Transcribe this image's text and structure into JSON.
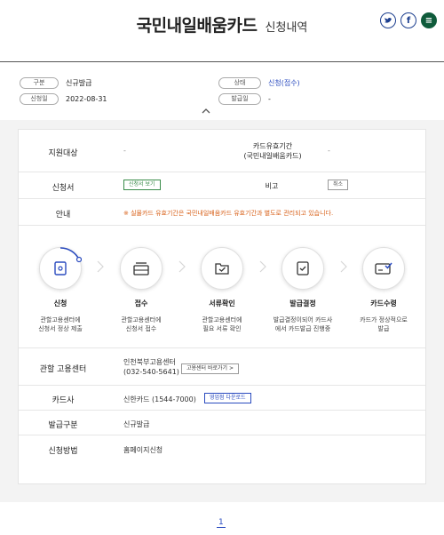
{
  "header": {
    "title": "국민내일배움카드",
    "subtitle": "신청내역",
    "share_twitter": "t",
    "share_facebook": "f",
    "share_other": "≡"
  },
  "summary": {
    "type_label": "구분",
    "type_value": "신규발급",
    "status_label": "상태",
    "status_value": "신청(접수)",
    "apply_date_label": "신청일",
    "apply_date_value": "2022-08-31",
    "issue_date_label": "발급일",
    "issue_date_value": "-"
  },
  "detail": {
    "support_label": "지원대상",
    "support_value": "-",
    "validity_label": "카드유효기간\n(국민내일배움카드)",
    "validity_value": "-",
    "application_label": "신청서",
    "application_button": "신청서 보기",
    "remark_label": "비고",
    "remark_button": "취소",
    "guide_label": "안내",
    "guide_value": "※ 실물카드 유효기간은 국민내일배움카드 유효기간과 별도로 관리되고 있습니다.",
    "center_label": "관할 고용센터",
    "center_name": "인천북부고용센터",
    "center_phone": "(032-540-5641)",
    "center_button": "고용센터 바로가기 >",
    "card_company_label": "카드사",
    "card_company_value": "신한카드 (1544-7000)",
    "card_company_button": "영업점 다운로드",
    "issue_type_label": "발급구분",
    "issue_type_value": "신규발급",
    "method_label": "신청방법",
    "method_value": "홈페이지신청"
  },
  "steps": [
    {
      "name": "신청",
      "desc": "관할고용센터에\n신청서 정상 제출",
      "icon": "doc-icon"
    },
    {
      "name": "접수",
      "desc": "관할고용센터에\n신청서 접수",
      "icon": "tray-icon"
    },
    {
      "name": "서류확인",
      "desc": "관할고용센터에\n필요 서류 확인",
      "icon": "folder-check-icon"
    },
    {
      "name": "발급결정",
      "desc": "발급결정이되어 카드사\n에서 카드발급 진행중",
      "icon": "doc-check-icon"
    },
    {
      "name": "카드수령",
      "desc": "카드가 정상적으로\n발급",
      "icon": "card-icon"
    }
  ],
  "pagination": {
    "current": "1"
  },
  "colors": {
    "accent_blue": "#2a4bbf",
    "notice_orange": "#d8621b",
    "green_button": "#3a8c4a"
  }
}
